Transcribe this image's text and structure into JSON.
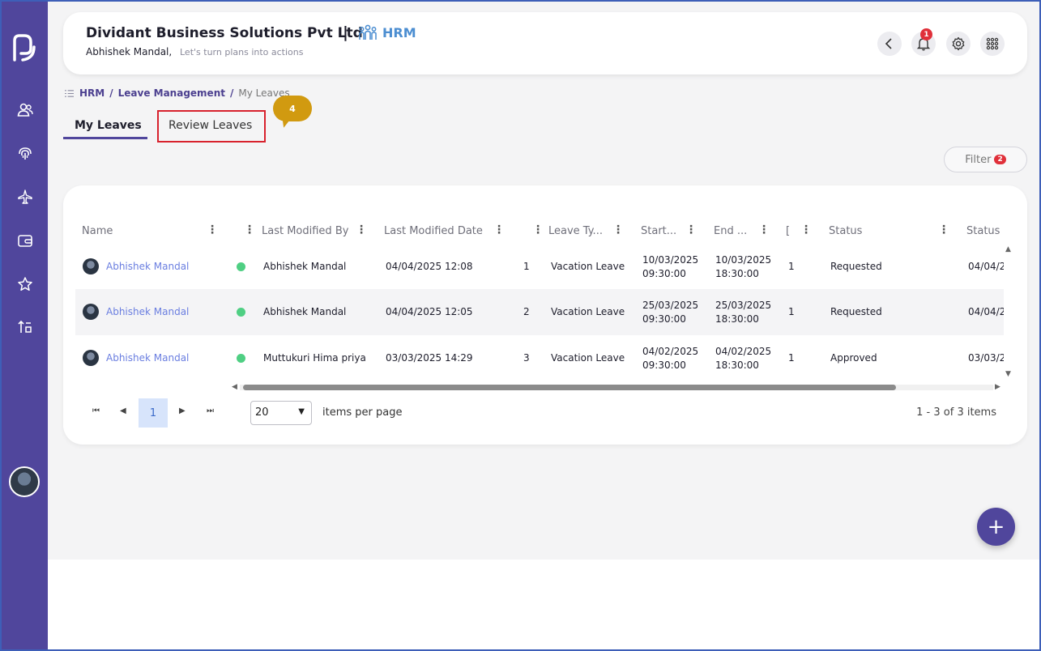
{
  "header": {
    "company": "Dividant Business Solutions Pvt Ltd",
    "separator": "|",
    "module": "HRM",
    "user": "Abhishek Mandal,",
    "tagline": "Let's turn plans into actions",
    "notification_count": "1"
  },
  "breadcrumb": {
    "items": [
      "HRM",
      "Leave Management",
      "My Leaves"
    ],
    "separator": "/"
  },
  "tabs": [
    "My Leaves",
    "Review Leaves"
  ],
  "tour_bubble": "4",
  "filter": {
    "label": "Filter",
    "count": "2"
  },
  "grid": {
    "columns": [
      "Name",
      "Last Modified By",
      "Last Modified Date",
      "Leave Ty...",
      "Start...",
      "End ...",
      "[",
      "Status",
      "Status"
    ],
    "rows": [
      {
        "name": "Abhishek Mandal",
        "modified_by": "Abhishek Mandal",
        "modified_date": "04/04/2025 12:08",
        "num": "1",
        "leave_type": "Vacation Leave",
        "start_date": "10/03/2025",
        "start_time": "09:30:00",
        "end_date": "10/03/2025",
        "end_time": "18:30:00",
        "days": "1",
        "status": "Requested",
        "status2": "04/04/2"
      },
      {
        "name": "Abhishek Mandal",
        "modified_by": "Abhishek Mandal",
        "modified_date": "04/04/2025 12:05",
        "num": "2",
        "leave_type": "Vacation Leave",
        "start_date": "25/03/2025",
        "start_time": "09:30:00",
        "end_date": "25/03/2025",
        "end_time": "18:30:00",
        "days": "1",
        "status": "Requested",
        "status2": "04/04/2"
      },
      {
        "name": "Abhishek Mandal",
        "modified_by": "Muttukuri Hima priya",
        "modified_date": "03/03/2025 14:29",
        "num": "3",
        "leave_type": "Vacation Leave",
        "start_date": "04/02/2025",
        "start_time": "09:30:00",
        "end_date": "04/02/2025",
        "end_time": "18:30:00",
        "days": "1",
        "status": "Approved",
        "status2": "03/03/2"
      }
    ]
  },
  "pager": {
    "current_page": "1",
    "page_size": "20",
    "items_label": "items per page",
    "info": "1 - 3 of 3 items"
  },
  "fab_label": "+",
  "colors": {
    "sidebar": "#50469c",
    "accent": "#50469c",
    "link": "#6a7ee0",
    "status_dot": "#4fcf83",
    "badge": "#e0303a",
    "tour": "#d19a10",
    "highlight_border": "#d8222d"
  }
}
